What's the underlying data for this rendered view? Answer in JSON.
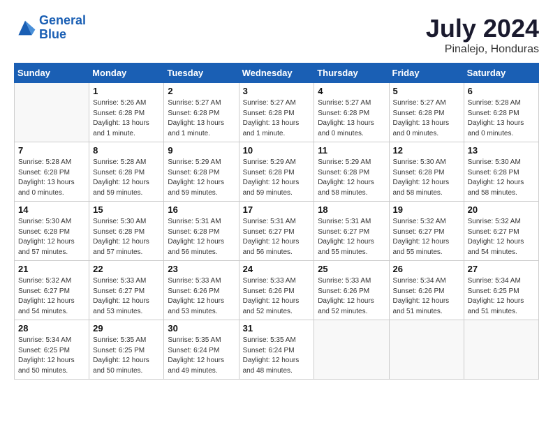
{
  "header": {
    "logo_line1": "General",
    "logo_line2": "Blue",
    "month": "July 2024",
    "location": "Pinalejo, Honduras"
  },
  "weekdays": [
    "Sunday",
    "Monday",
    "Tuesday",
    "Wednesday",
    "Thursday",
    "Friday",
    "Saturday"
  ],
  "weeks": [
    [
      {
        "day": "",
        "info": ""
      },
      {
        "day": "1",
        "info": "Sunrise: 5:26 AM\nSunset: 6:28 PM\nDaylight: 13 hours\nand 1 minute."
      },
      {
        "day": "2",
        "info": "Sunrise: 5:27 AM\nSunset: 6:28 PM\nDaylight: 13 hours\nand 1 minute."
      },
      {
        "day": "3",
        "info": "Sunrise: 5:27 AM\nSunset: 6:28 PM\nDaylight: 13 hours\nand 1 minute."
      },
      {
        "day": "4",
        "info": "Sunrise: 5:27 AM\nSunset: 6:28 PM\nDaylight: 13 hours\nand 0 minutes."
      },
      {
        "day": "5",
        "info": "Sunrise: 5:27 AM\nSunset: 6:28 PM\nDaylight: 13 hours\nand 0 minutes."
      },
      {
        "day": "6",
        "info": "Sunrise: 5:28 AM\nSunset: 6:28 PM\nDaylight: 13 hours\nand 0 minutes."
      }
    ],
    [
      {
        "day": "7",
        "info": "Sunrise: 5:28 AM\nSunset: 6:28 PM\nDaylight: 13 hours\nand 0 minutes."
      },
      {
        "day": "8",
        "info": "Sunrise: 5:28 AM\nSunset: 6:28 PM\nDaylight: 12 hours\nand 59 minutes."
      },
      {
        "day": "9",
        "info": "Sunrise: 5:29 AM\nSunset: 6:28 PM\nDaylight: 12 hours\nand 59 minutes."
      },
      {
        "day": "10",
        "info": "Sunrise: 5:29 AM\nSunset: 6:28 PM\nDaylight: 12 hours\nand 59 minutes."
      },
      {
        "day": "11",
        "info": "Sunrise: 5:29 AM\nSunset: 6:28 PM\nDaylight: 12 hours\nand 58 minutes."
      },
      {
        "day": "12",
        "info": "Sunrise: 5:30 AM\nSunset: 6:28 PM\nDaylight: 12 hours\nand 58 minutes."
      },
      {
        "day": "13",
        "info": "Sunrise: 5:30 AM\nSunset: 6:28 PM\nDaylight: 12 hours\nand 58 minutes."
      }
    ],
    [
      {
        "day": "14",
        "info": "Sunrise: 5:30 AM\nSunset: 6:28 PM\nDaylight: 12 hours\nand 57 minutes."
      },
      {
        "day": "15",
        "info": "Sunrise: 5:30 AM\nSunset: 6:28 PM\nDaylight: 12 hours\nand 57 minutes."
      },
      {
        "day": "16",
        "info": "Sunrise: 5:31 AM\nSunset: 6:28 PM\nDaylight: 12 hours\nand 56 minutes."
      },
      {
        "day": "17",
        "info": "Sunrise: 5:31 AM\nSunset: 6:27 PM\nDaylight: 12 hours\nand 56 minutes."
      },
      {
        "day": "18",
        "info": "Sunrise: 5:31 AM\nSunset: 6:27 PM\nDaylight: 12 hours\nand 55 minutes."
      },
      {
        "day": "19",
        "info": "Sunrise: 5:32 AM\nSunset: 6:27 PM\nDaylight: 12 hours\nand 55 minutes."
      },
      {
        "day": "20",
        "info": "Sunrise: 5:32 AM\nSunset: 6:27 PM\nDaylight: 12 hours\nand 54 minutes."
      }
    ],
    [
      {
        "day": "21",
        "info": "Sunrise: 5:32 AM\nSunset: 6:27 PM\nDaylight: 12 hours\nand 54 minutes."
      },
      {
        "day": "22",
        "info": "Sunrise: 5:33 AM\nSunset: 6:27 PM\nDaylight: 12 hours\nand 53 minutes."
      },
      {
        "day": "23",
        "info": "Sunrise: 5:33 AM\nSunset: 6:26 PM\nDaylight: 12 hours\nand 53 minutes."
      },
      {
        "day": "24",
        "info": "Sunrise: 5:33 AM\nSunset: 6:26 PM\nDaylight: 12 hours\nand 52 minutes."
      },
      {
        "day": "25",
        "info": "Sunrise: 5:33 AM\nSunset: 6:26 PM\nDaylight: 12 hours\nand 52 minutes."
      },
      {
        "day": "26",
        "info": "Sunrise: 5:34 AM\nSunset: 6:26 PM\nDaylight: 12 hours\nand 51 minutes."
      },
      {
        "day": "27",
        "info": "Sunrise: 5:34 AM\nSunset: 6:25 PM\nDaylight: 12 hours\nand 51 minutes."
      }
    ],
    [
      {
        "day": "28",
        "info": "Sunrise: 5:34 AM\nSunset: 6:25 PM\nDaylight: 12 hours\nand 50 minutes."
      },
      {
        "day": "29",
        "info": "Sunrise: 5:35 AM\nSunset: 6:25 PM\nDaylight: 12 hours\nand 50 minutes."
      },
      {
        "day": "30",
        "info": "Sunrise: 5:35 AM\nSunset: 6:24 PM\nDaylight: 12 hours\nand 49 minutes."
      },
      {
        "day": "31",
        "info": "Sunrise: 5:35 AM\nSunset: 6:24 PM\nDaylight: 12 hours\nand 48 minutes."
      },
      {
        "day": "",
        "info": ""
      },
      {
        "day": "",
        "info": ""
      },
      {
        "day": "",
        "info": ""
      }
    ]
  ]
}
